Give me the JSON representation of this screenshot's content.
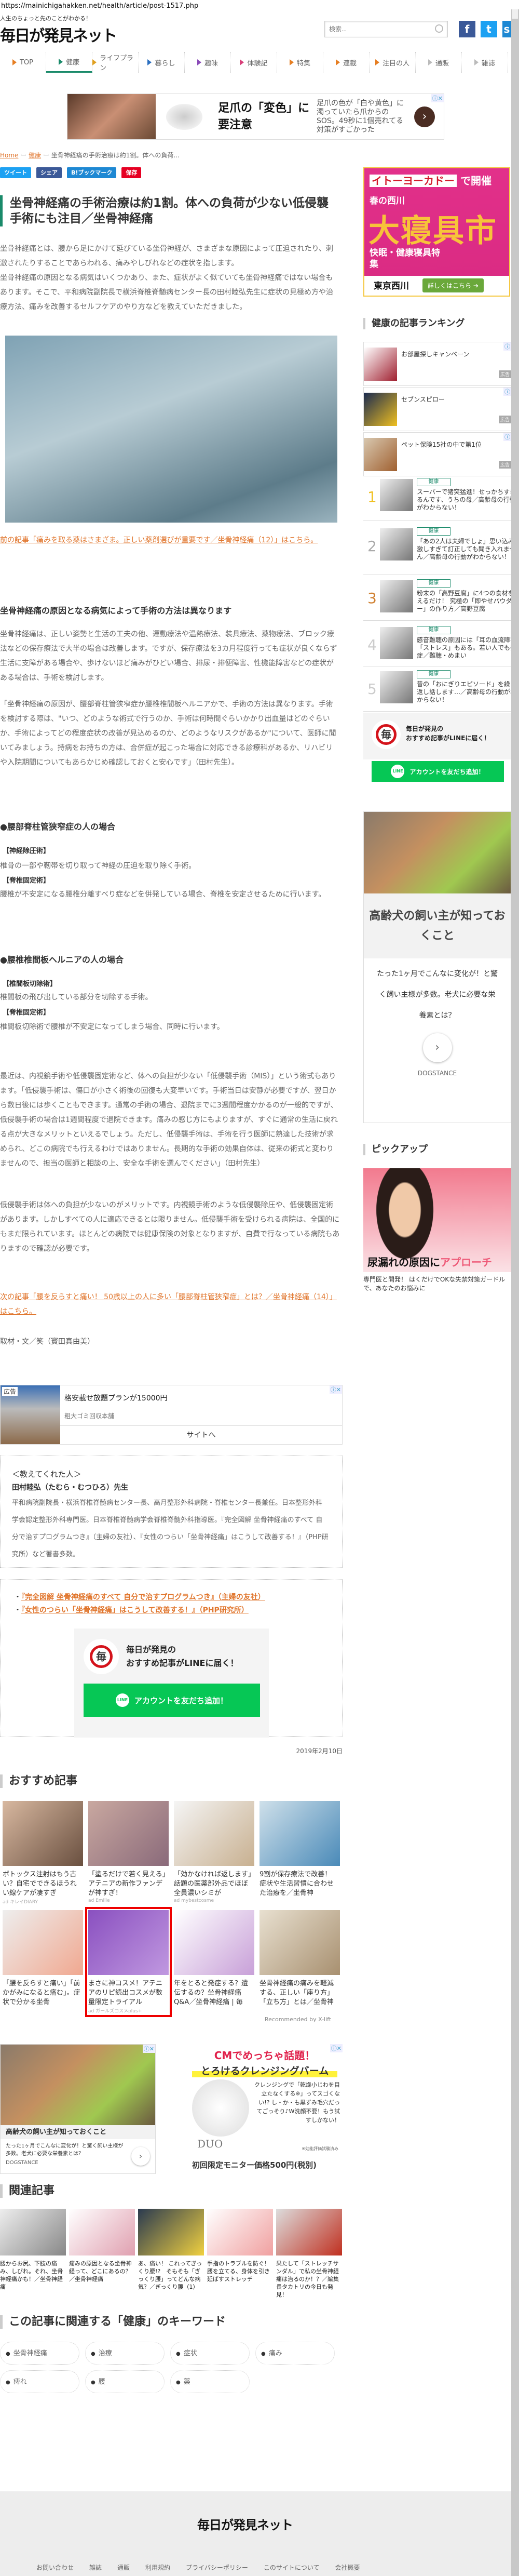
{
  "browser": {
    "url": "https://mainichigahakken.net/health/article/post-1517.php"
  },
  "header": {
    "tagline": "人生のちょっと先のことがわかる！",
    "logo": "毎日が発見ネット",
    "search_placeholder": "検索...",
    "social": [
      "f",
      "t",
      "s"
    ]
  },
  "nav": [
    {
      "label": "TOP",
      "color": "#e67e22"
    },
    {
      "label": "健康",
      "color": "#1a8a6a",
      "active": true
    },
    {
      "label": "ライフプラン",
      "color": "#e0a020"
    },
    {
      "label": "暮らし",
      "color": "#2a6fc0"
    },
    {
      "label": "趣味",
      "color": "#8a4ab8"
    },
    {
      "label": "体験記",
      "color": "#d8407a"
    },
    {
      "label": "特集",
      "color": "#e67e22"
    },
    {
      "label": "連載",
      "color": "#e67e22"
    },
    {
      "label": "注目の人",
      "color": "#e67e22"
    },
    {
      "label": "通販",
      "color": "#bbbbbb"
    },
    {
      "label": "雑誌",
      "color": "#bbbbbb"
    }
  ],
  "top_ad": {
    "headline": "足爪の「変色」に要注意",
    "desc": "足爪の色が「白や黄色」に濁っていたら爪からのSOS。49秒に1個売れてる対策がすごかった"
  },
  "breadcrumb": {
    "home": "Home",
    "category": "健康",
    "current": "坐骨神経痛の手術治療は約1割。体への負荷..."
  },
  "share": [
    {
      "label": "ツイート",
      "color": "#1da1f2"
    },
    {
      "label": "シェア",
      "color": "#3b5998"
    },
    {
      "label": "B!ブックマーク",
      "color": "#1e88d3"
    },
    {
      "label": "保存",
      "color": "#e60023"
    }
  ],
  "article": {
    "title": "坐骨神経痛の手術治療は約1割。体への負荷が少ない低侵襲手術にも注目／坐骨神経痛",
    "intro": "坐骨神経痛とは、腰から足にかけて延びている坐骨神経が、さまざまな原因によって圧迫されたり、刺激されたりすることであらわれる、痛みやしびれなどの症状を指します。\n坐骨神経痛の原因となる病気はいくつかあり、また、症状がよく似ていても坐骨神経痛ではない場合もあります。そこで、平和病院副院長で横浜脊椎脊髄病センター長の田村睦弘先生に症状の見極め方や治療方法、痛みを改善するセルフケアのやり方などを教えていただきました。",
    "prev_link": "前の記事「痛みを取る薬はさまざま。正しい薬剤選びが重要です／坐骨神経痛（12）」はこちら。",
    "h2": "坐骨神経痛の原因となる病気によって手術の方法は異なります",
    "p1": "坐骨神経痛は、正しい姿勢と生活の工夫の他、運動療法や温熱療法、装具療法、薬物療法、ブロック療法などの保存療法で大半の場合は改善します。ですが、保存療法を3カ月程度行っても症状が良くならず生活に支障がある場合や、歩けないほど痛みがひどい場合、排尿・排便障害、性機能障害などの症状がある場合は、手術を検討します。",
    "p2": "「坐骨神経痛の原因が、腰部脊柱管狭窄症か腰椎椎間板ヘルニアかで、手術の方法は異なります。手術を検討する際は、\"いつ、どのような術式で行うのか、手術は何時間ぐらいかかり出血量はどのぐらいか、手術によってどの程度症状の改善が見込めるのか、どのようなリスクがあるか\"について、医師に聞いてみましょう。持病をお持ちの方は、合併症が起こった場合に対応できる診療科があるか、リハビリや入院期間についてもあらかじめ確認しておくと安心です」（田村先生）。",
    "s1_h": "●腰部脊柱管狭窄症の人の場合",
    "s1": [
      {
        "label": "【神経除圧術】",
        "text": "椎骨の一部や靭帯を切り取って神経の圧迫を取り除く手術。"
      },
      {
        "label": "【脊椎固定術】",
        "text": "腰椎が不安定になる腰椎分離すべり症などを併発している場合、脊椎を安定させるために行います。"
      }
    ],
    "s2_h": "●腰椎椎間板ヘルニアの人の場合",
    "s2": [
      {
        "label": "【椎間板切除術】",
        "text": "椎間板の飛び出している部分を切除する手術。"
      },
      {
        "label": "【脊椎固定術】",
        "text": "椎間板切除術で腰椎が不安定になってしまう場合、同時に行います。"
      }
    ],
    "p3": "最近は、内視鏡手術や低侵襲固定術など、体への負担が少ない「低侵襲手術（MIS）」という術式もあります。「低侵襲手術は、傷口が小さく術後の回復も大変早いです。手術当日は安静が必要ですが、翌日から数日後には歩くこともできます。通常の手術の場合、退院までに3週間程度かかるのが一般的ですが、低侵襲手術の場合は1週間程度で退院できます。痛みの感じ方にもよりますが、すぐに通常の生活に戻れる点が大きなメリットといえるでしょう。ただし、低侵襲手術は、手術を行う医師に熟達した技術が求められ、どこの病院でも行えるわけではありません。長期的な手術の効果自体は、従来の術式と変わりませんので、担当の医師と相談の上、安全な手術を選んでください」（田村先生）",
    "p4": "低侵襲手術は体への負担が少ないのがメリットです。内視鏡手術のような低侵襲除圧や、低侵襲固定術があります。しかしすべての人に適応できるとは限りません。低侵襲手術を受けられる病院は、全国的にもまだ限られています。ほとんどの病院では健康保険の対象となりますが、自費で行なっている病院もありますので確認が必要です。",
    "next_link": "次の記事「腰を反らすと痛い！ 50歳以上の人に多い「腰部脊柱管狭窄症」とは？／坐骨神経痛（14）」はこちら。",
    "credit": "取材・文／笑（寳田真由美）",
    "date": "2019年2月10日"
  },
  "mid_ad": {
    "tag": "広告",
    "title": "格安載せ放題プランが15000円",
    "sponsor": "粗大ゴミ回収本舗",
    "cta": "サイトへ"
  },
  "profile": {
    "heading": "＜教えてくれた人＞",
    "name": "田村睦弘（たむら・むつひろ）先生",
    "bio": "平和病院副院長・横浜脊椎脊髄病センター長、高月整形外科病院・脊椎センター長兼任。日本整形外科学会認定整形外科専門医。日本脊椎脊髄病学会脊椎脊髄外科指導医。『完全図解 坐骨神経痛のすべて 自分で治すプログラムつき』（主婦の友社）、『女性のつらい「坐骨神経痛」はこうして改善する！』（PHP研究所）など著書多数。"
  },
  "books": [
    "『完全図解 坐骨神経痛のすべて 自分で治すプログラムつき』（主婦の友社）",
    "『女性のつらい「坐骨神経痛」はこうして改善する！』（PHP研究所）"
  ],
  "line_promo": {
    "logo": "毎",
    "line1": "毎日が発見の",
    "line2": "おすすめ記事がLINEに届く！",
    "button": "アカウントを友だち追加！",
    "line_icon": "LINE"
  },
  "recommended": {
    "heading": "おすすめ記事",
    "items": [
      {
        "caption": "ボトックス注射はもう古い？自宅でできるほうれい線ケアが凄すぎ",
        "source": "ad キレイDIARY"
      },
      {
        "caption": "「塗るだけで若く見える」アテニアの新作ファンデが神すぎ！",
        "source": "ad Emilie"
      },
      {
        "caption": "「効かなければ返します」話題の医薬部外品でほぼ全員濃いシミが",
        "source": "ad mybestcosme"
      },
      {
        "caption": "9割が保存療法で改善！　症状や生活習慣に合わせた治療を／坐骨神",
        "source": ""
      },
      {
        "caption": "「腰を反らすと痛い」「前かがみになると痛む」。症状で分かる坐骨",
        "source": ""
      },
      {
        "caption": "まさに神コスメ！アテニアのリピ続出コスメが数量限定トライアル",
        "source": "ad ガールズコスメplus+",
        "highlight": true
      },
      {
        "caption": "年をとると発症する？遺伝するの？坐骨神経痛Q&A／坐骨神経痛 | 毎",
        "source": ""
      },
      {
        "caption": "坐骨神経痛の痛みを軽減する、正しい「座り方」「立ち方」とは／坐骨神",
        "source": ""
      }
    ],
    "powered": "Recommended by X-lift"
  },
  "bottom_ads": {
    "dog": {
      "title": "高齢犬の飼い主が知っておくこと",
      "text": "たった1ヶ月でこんなに変化が！と驚く飼い主様が多数。老犬に必要な栄養素とは？",
      "brand": "DOGSTANCE"
    },
    "balm": {
      "l1": "CMでめっちゃ話題！",
      "l2": "とろけるクレンジングバーム",
      "l3": "クレンジングで「乾燥小じわを目立たなくする※」ってスゴくない!? し・か・も黒ずみ毛穴だってごっそり♪W洗顔不要！もう試すしかない！",
      "note": "※効能評価試験済み",
      "brand": "DUO",
      "price": "初回限定モニター価格500円(税別)"
    }
  },
  "related": {
    "heading": "関連記事",
    "items": [
      "腰からお尻、下肢の痛み、しびれ。それ、坐骨神経痛かも！／坐骨神経痛",
      "痛みの原因となる坐骨神経って、どこにあるの？／坐骨神経痛",
      "あ、痛い！ これってぎっくり腰!?　そもそも「ぎっくり腰」ってどんな病気？／ぎっくり腰（1）",
      "手指のトラブルを防ぐ！　腰を立てる、身体を引き延ばすストレッチ",
      "果たして「ストレッチサンダル」で私の坐骨神経痛は治るのか！？／編集長タカトリの今日も発見！"
    ]
  },
  "keywords": {
    "heading": "この記事に関連する「健康」のキーワード",
    "items": [
      "坐骨神経痛",
      "治療",
      "症状",
      "痛み",
      "痺れ",
      "腰",
      "薬"
    ]
  },
  "footer": {
    "logo": "毎日が発見ネット",
    "links": [
      "お問い合わせ",
      "雑誌",
      "通販",
      "利用規約",
      "プライバシーポリシー",
      "このサイトについて",
      "会社概要"
    ]
  },
  "sidebar": {
    "ad": {
      "l1a": "イトーヨーカドー",
      "l1b": "で開催",
      "l2": "春の西川",
      "l3": "大寝具市",
      "l4": "快眠・健康寝具特集",
      "l5": "東京西川",
      "cta": "詳しくはこちら ➔"
    },
    "ranking_heading": "健康の記事ランキング",
    "ranking_ads": [
      {
        "title": "お部屋探しキャンペーン",
        "tag": "広告"
      },
      {
        "title": "セブンスピロー",
        "tag": "広告"
      },
      {
        "title": "ペット保険15社の中で第1位",
        "tag": "広告"
      }
    ],
    "ranking": [
      {
        "rank": "1",
        "tag": "健康",
        "title": "スーパーで猪突猛進！せっかちすぎるんです、うちの母／高齢母の行動がわからない！",
        "color": "#f0c020"
      },
      {
        "rank": "2",
        "tag": "健康",
        "title": "「あの2人は夫婦でしょ」思い込みが激しすぎて訂正しても聞き入れません／高齢母の行動がわからない！",
        "color": "#aaaaaa"
      },
      {
        "rank": "3",
        "tag": "健康",
        "title": "粉末の「高野豆腐」に4つの食材を加えるだけ！ 究極の「即やせパウダー」の作り方／高野豆腐",
        "color": "#d08030"
      },
      {
        "rank": "4",
        "tag": "健康",
        "title": "感音難聴の原因には「耳の血流障害」「ストレス」もある。若い人でも発症／難聴・めまい",
        "color": "#cccccc"
      },
      {
        "rank": "5",
        "tag": "健康",
        "title": "昔の「おにぎりエピソード」を繰り返し話します…／高齢母の行動がわからない！",
        "color": "#cccccc"
      }
    ],
    "pickup_heading": "ピックアップ",
    "pickup": {
      "img_a": "尿漏れの原因に",
      "img_b": "アプローチ",
      "caption": "専門医と開発！ はくだけでOKな失禁対策ガードルで、あなたのお悩みに"
    }
  }
}
